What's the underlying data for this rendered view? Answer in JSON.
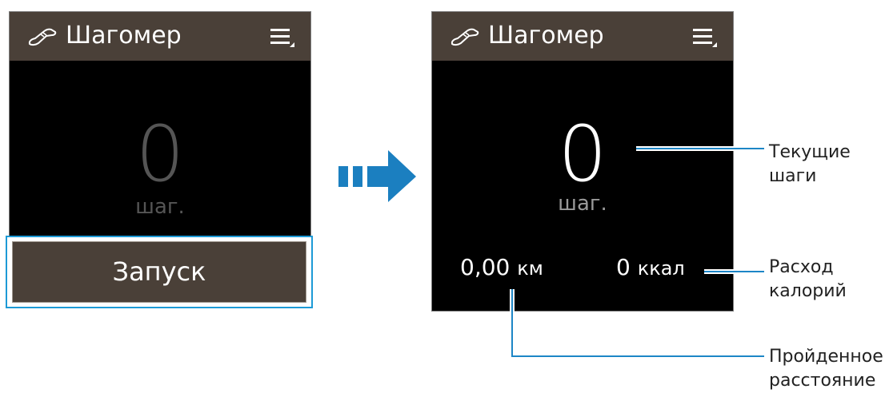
{
  "app": {
    "title": "Шагомер",
    "icon": "shoe-icon",
    "menu_icon": "menu-icon"
  },
  "left_screen": {
    "steps_value": "0",
    "steps_unit": "шаг.",
    "start_label": "Запуск"
  },
  "right_screen": {
    "steps_value": "0",
    "steps_unit": "шаг.",
    "distance_value": "0,00",
    "distance_unit": "км",
    "calories_value": "0",
    "calories_unit": "ккал"
  },
  "callouts": {
    "steps": [
      "Текущие",
      "шаги"
    ],
    "calories": [
      "Расход",
      "калорий"
    ],
    "distance": [
      "Пройденное",
      "расстояние"
    ]
  },
  "colors": {
    "header": "#4a4038",
    "screen": "#000000",
    "highlight": "#1d9ad6",
    "arrow": "#1b7fc0",
    "callout_line": "#1d86c6"
  }
}
